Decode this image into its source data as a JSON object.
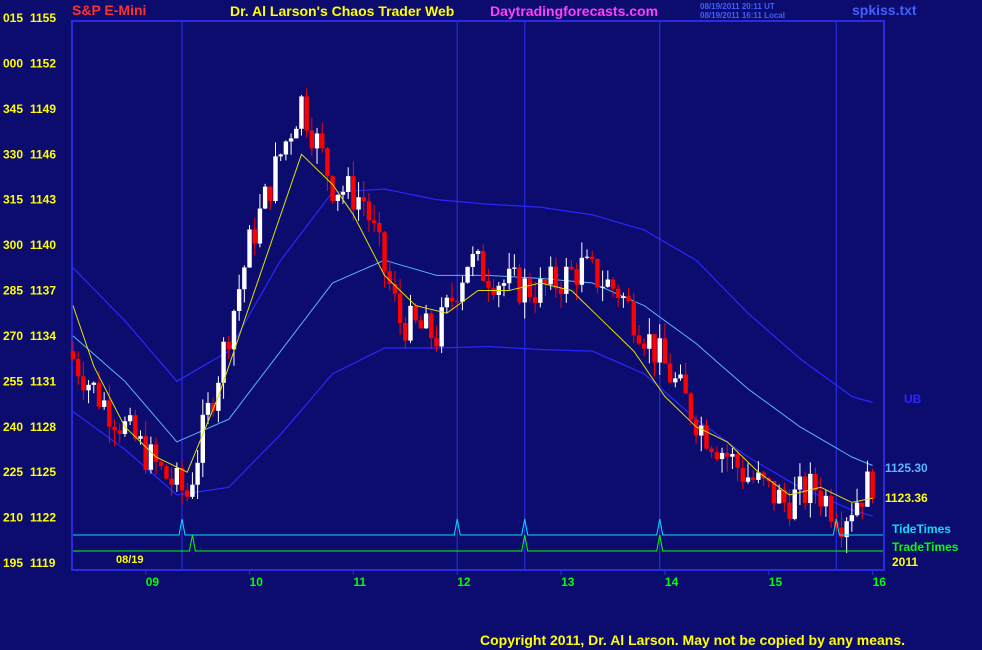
{
  "header": {
    "instrument": "S&P E-Mini",
    "title": "Dr. Al Larson's Chaos Trader Web",
    "site": "Daytradingforecasts.com",
    "stamp_line1": "08/19/2011 20:11 UT",
    "stamp_line2": "08/19/2011 16:11 Local",
    "file": "spkiss.txt"
  },
  "footer": {
    "copyright": "Copyright 2011, Dr. Al Larson. May not be copied by any means."
  },
  "colors": {
    "background": "#0c0c6e",
    "frame": "#2a2ae0",
    "axis_text": "#ffff00",
    "day_text": "#00ff00",
    "up_candle": "#ffffff",
    "down_candle": "#ff0000",
    "ma_fast": "#e0e000",
    "band_mid": "#5ab4ff",
    "band_outer": "#2828ff",
    "tide": "#00e0ff",
    "trade": "#00ff00",
    "day_line": "#2a2ae0",
    "instrument": "#ff3030",
    "title": "#ffff00",
    "site": "#ff40ff",
    "file": "#4060ff"
  },
  "chart_data": {
    "type": "candlestick",
    "ylim": [
      1119,
      1155
    ],
    "y_ticks": [
      {
        "time": "015",
        "price": "1155",
        "v": 1155
      },
      {
        "time": "000",
        "price": "1152",
        "v": 1152
      },
      {
        "time": "345",
        "price": "1149",
        "v": 1149
      },
      {
        "time": "330",
        "price": "1146",
        "v": 1146
      },
      {
        "time": "315",
        "price": "1143",
        "v": 1143
      },
      {
        "time": "300",
        "price": "1140",
        "v": 1140
      },
      {
        "time": "285",
        "price": "1137",
        "v": 1137
      },
      {
        "time": "270",
        "price": "1134",
        "v": 1134
      },
      {
        "time": "255",
        "price": "1131",
        "v": 1131
      },
      {
        "time": "240",
        "price": "1128",
        "v": 1128
      },
      {
        "time": "225",
        "price": "1125",
        "v": 1125
      },
      {
        "time": "210",
        "price": "1122",
        "v": 1122
      },
      {
        "time": "195",
        "price": "1119",
        "v": 1119
      }
    ],
    "x_labels": [
      "09",
      "10",
      "11",
      "12",
      "13",
      "14",
      "15",
      "16"
    ],
    "x_label_hours": [
      9,
      10,
      11,
      12,
      13,
      14,
      15,
      16
    ],
    "xlim": [
      8.3,
      16.1
    ],
    "date_label": "08/19",
    "year_label": "2011",
    "last_price_label": "1125.30",
    "ma_value_label": "1123.36",
    "band_label": "UB",
    "tide_label": "TideTimes",
    "trade_label": "TradeTimes",
    "tide_times": [
      9.35,
      12.0,
      12.65,
      13.95,
      15.65
    ],
    "trade_times": [
      9.45,
      12.65,
      13.95
    ],
    "time_lines": [
      9.35,
      12.0,
      12.65,
      13.95,
      15.65
    ],
    "ohlc_anchor_times": [
      8.3,
      8.6,
      8.9,
      9.2,
      9.45,
      9.8,
      10.05,
      10.35,
      10.55,
      10.85,
      11.15,
      11.5,
      11.85,
      12.15,
      12.5,
      12.85,
      13.25,
      13.6,
      14.05,
      14.4,
      14.8,
      15.2,
      15.5,
      15.75,
      16.05
    ],
    "ohlc_anchor_prices": [
      1133,
      1130,
      1127.5,
      1125,
      1123.5,
      1133,
      1140,
      1146,
      1149.5,
      1144,
      1143,
      1135,
      1134,
      1139,
      1137.5,
      1137,
      1138.5,
      1137,
      1132,
      1128,
      1125,
      1123,
      1124,
      1122,
      1124.5
    ],
    "ma_fast_times": [
      8.3,
      8.5,
      8.8,
      9.1,
      9.4,
      9.7,
      10.0,
      10.3,
      10.5,
      10.8,
      11.0,
      11.3,
      11.6,
      11.9,
      12.2,
      12.5,
      12.8,
      13.1,
      13.4,
      13.7,
      14.0,
      14.3,
      14.6,
      14.9,
      15.2,
      15.5,
      15.8,
      16.05
    ],
    "ma_fast_values": [
      1136,
      1132,
      1128,
      1126,
      1125,
      1130,
      1136,
      1142,
      1146,
      1144,
      1142,
      1138,
      1136,
      1135.5,
      1137,
      1137,
      1137.5,
      1137,
      1135,
      1133,
      1130,
      1128,
      1127,
      1125,
      1123.5,
      1124,
      1123,
      1123.36
    ],
    "ma_slow_times": [
      8.3,
      8.8,
      9.3,
      9.8,
      10.3,
      10.8,
      11.3,
      11.8,
      12.3,
      12.8,
      13.3,
      13.8,
      14.3,
      14.8,
      15.3,
      15.8,
      16.05
    ],
    "ma_slow_values": [
      1134,
      1131,
      1127,
      1128.5,
      1133,
      1137.5,
      1139,
      1138,
      1138,
      1137.8,
      1137.5,
      1136,
      1133.5,
      1130.5,
      1128,
      1126,
      1125.3
    ],
    "band_upper_times": [
      8.3,
      8.8,
      9.3,
      9.8,
      10.3,
      10.8,
      11.3,
      11.8,
      12.3,
      12.8,
      13.3,
      13.8,
      14.3,
      14.8,
      15.3,
      15.8,
      16.05
    ],
    "band_upper_values": [
      1138.5,
      1135,
      1131,
      1133,
      1139,
      1143.5,
      1143.7,
      1143,
      1142.7,
      1142.5,
      1142,
      1141,
      1139,
      1135.5,
      1132.5,
      1130,
      1129.5
    ],
    "band_lower_times": [
      8.3,
      8.8,
      9.3,
      9.8,
      10.3,
      10.8,
      11.3,
      11.8,
      12.3,
      12.8,
      13.3,
      13.8,
      14.3,
      14.8,
      15.3,
      15.8,
      16.05
    ],
    "band_lower_values": [
      1129,
      1126.5,
      1123.5,
      1124,
      1127.5,
      1131.5,
      1133.2,
      1133.2,
      1133.3,
      1133.1,
      1133,
      1131.5,
      1128.5,
      1126,
      1124,
      1122.5,
      1122
    ],
    "candle_noise_seed": 7
  }
}
